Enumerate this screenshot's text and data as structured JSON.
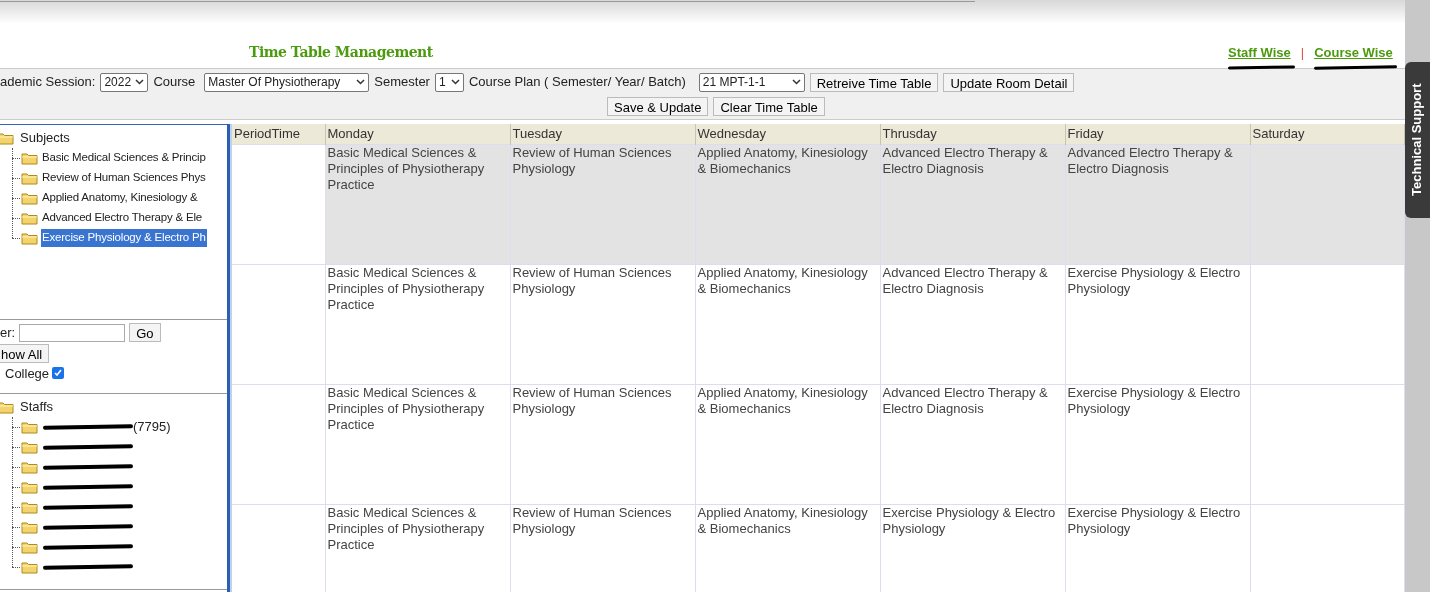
{
  "header": {
    "title": "Time Table Management",
    "links": [
      {
        "label": "Staff Wise",
        "annotated": true
      },
      {
        "label": "Course Wise",
        "annotated": true
      }
    ],
    "separator": "|"
  },
  "toolbar": {
    "session_label": "ademic Session:",
    "session": "2022",
    "course_label": "Course",
    "course": "Master Of Physiotherapy",
    "semester_label": "Semester",
    "semester": "1",
    "plan_label": "Course Plan ( Semester/ Year/ Batch)",
    "plan": "21 MPT-1-1",
    "buttons": [
      "Retreive Time Table",
      "Update Room Detail"
    ],
    "buttons_row2": [
      "Save & Update",
      "Clear Time Table"
    ]
  },
  "subjects": {
    "title": "Subjects",
    "items": [
      {
        "label": "Basic Medical Sciences & Princip",
        "selected": false
      },
      {
        "label": "Review of Human Sciences Phys",
        "selected": false
      },
      {
        "label": "Applied Anatomy, Kinesiology &",
        "selected": false
      },
      {
        "label": "Advanced Electro Therapy & Ele",
        "selected": false
      },
      {
        "label": "Exercise Physiology & Electro Ph",
        "selected": true
      }
    ]
  },
  "filter": {
    "label": "er:",
    "go": "Go",
    "show_all": "how All",
    "college_label": "College",
    "college_checked": true
  },
  "staffs": {
    "title": "Staffs",
    "items": [
      {
        "redacted": true,
        "visible": "(7795)"
      },
      {
        "redacted": true
      },
      {
        "redacted": true
      },
      {
        "redacted": true
      },
      {
        "redacted": true
      },
      {
        "redacted": true
      },
      {
        "redacted": true
      },
      {
        "redacted": true
      }
    ]
  },
  "timetable": {
    "columns": [
      "PeriodTime",
      "Monday",
      "Tuesday",
      "Wednesday",
      "Thrusday",
      "Friday",
      "Saturday"
    ],
    "rows": [
      {
        "highlighted": true,
        "cells": [
          "",
          "Basic Medical Sciences & Principles of Physiotherapy Practice",
          "Review of Human Sciences Physiology",
          "Applied Anatomy, Kinesiology & Biomechanics",
          "Advanced Electro Therapy & Electro Diagnosis",
          "Advanced Electro Therapy & Electro Diagnosis",
          ""
        ]
      },
      {
        "highlighted": false,
        "cells": [
          "",
          "Basic Medical Sciences & Principles of Physiotherapy Practice",
          "Review of Human Sciences Physiology",
          "Applied Anatomy, Kinesiology & Biomechanics",
          "Advanced Electro Therapy & Electro Diagnosis",
          "Exercise Physiology & Electro Physiology",
          ""
        ]
      },
      {
        "highlighted": false,
        "cells": [
          "",
          "Basic Medical Sciences & Principles of Physiotherapy Practice",
          "Review of Human Sciences Physiology",
          "Applied Anatomy, Kinesiology & Biomechanics",
          "Advanced Electro Therapy & Electro Diagnosis",
          "Exercise Physiology & Electro Physiology",
          ""
        ]
      },
      {
        "highlighted": false,
        "cells": [
          "",
          "Basic Medical Sciences & Principles of Physiotherapy Practice",
          "Review of Human Sciences Physiology",
          "Applied Anatomy, Kinesiology & Biomechanics",
          "Exercise Physiology & Electro Physiology",
          "Exercise Physiology & Electro Physiology",
          ""
        ]
      }
    ]
  },
  "support_tab": "Technical Support"
}
